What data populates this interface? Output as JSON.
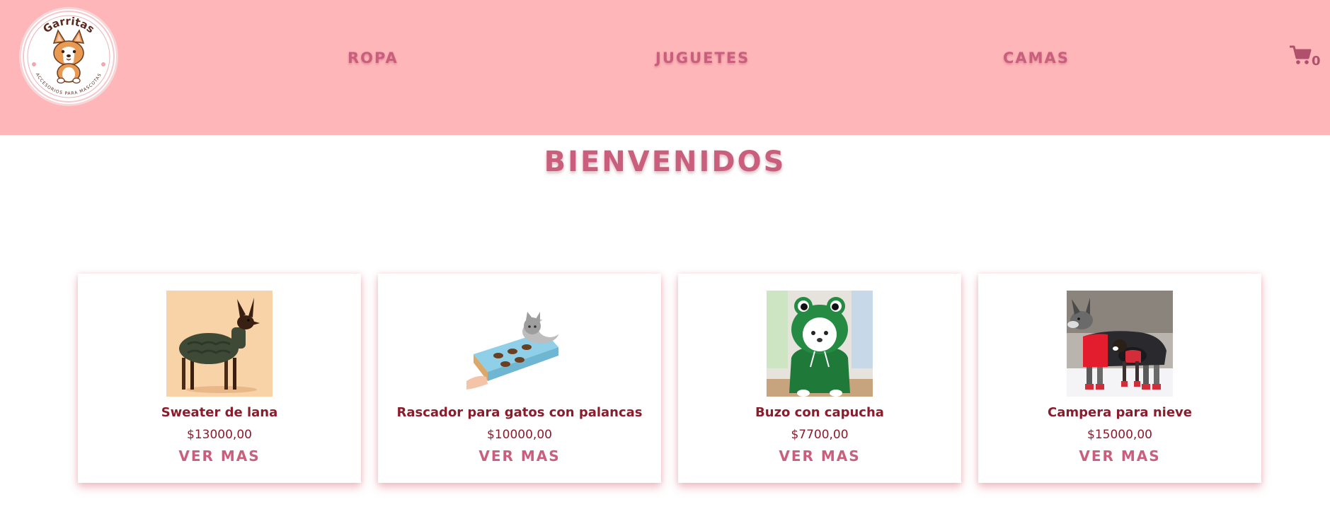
{
  "brand": {
    "name": "Garritas",
    "tagline": "ACCESORIOS PARA MASCOTAS"
  },
  "nav": {
    "items": [
      {
        "label": "ROPA"
      },
      {
        "label": "JUGUETES"
      },
      {
        "label": "CAMAS"
      }
    ]
  },
  "cart": {
    "icon": "cart-icon",
    "count": "0"
  },
  "page": {
    "title": "BIENVENIDOS"
  },
  "products": [
    {
      "name": "Sweater de lana",
      "price": "$13000,00",
      "cta": "VER MAS",
      "image": "dog-sweater-image"
    },
    {
      "name": "Rascador para gatos con palancas",
      "price": "$10000,00",
      "cta": "VER MAS",
      "image": "cat-scratcher-image"
    },
    {
      "name": "Buzo con capucha",
      "price": "$7700,00",
      "cta": "VER MAS",
      "image": "frog-hoodie-image"
    },
    {
      "name": "Campera para nieve",
      "price": "$15000,00",
      "cta": "VER MAS",
      "image": "snow-jacket-image"
    }
  ],
  "colors": {
    "header_bg": "#ffb6b9",
    "accent": "#c95f7d",
    "text_dark": "#8a1c2c"
  }
}
